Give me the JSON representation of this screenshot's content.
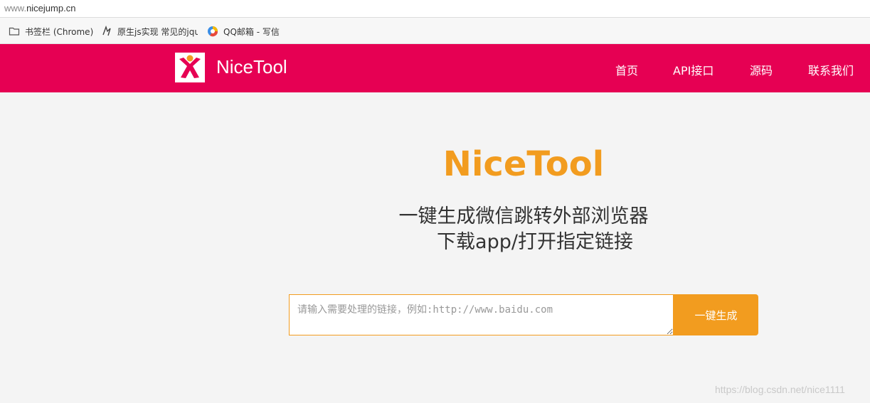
{
  "browser": {
    "url_prefix": "www.",
    "url_domain": "nicejump.cn",
    "bookmarks": [
      {
        "label": "书签栏 (Chrome)",
        "icon": "folder-icon"
      },
      {
        "label": "原生js实现 常见的jquery",
        "icon": "bookmark-favicon-icon"
      },
      {
        "label": "QQ邮箱 - 写信",
        "icon": "qq-mail-favicon-icon"
      }
    ]
  },
  "navbar": {
    "brand": "NiceTool",
    "logo_icon": "nicetool-logo-icon",
    "links": [
      "首页",
      "API接口",
      "源码",
      "联系我们"
    ],
    "bg_color": "#e60053"
  },
  "hero": {
    "title": "NiceTool",
    "line1": "一键生成微信跳转外部浏览器",
    "line2": "下载app/打开指定链接",
    "title_color": "#f29c1f"
  },
  "form": {
    "placeholder": "请输入需要处理的链接，例如:http://www.baidu.com",
    "value": "",
    "button_label": "一键生成",
    "accent_color": "#f29c1f"
  },
  "watermark": "https://blog.csdn.net/nice1111"
}
